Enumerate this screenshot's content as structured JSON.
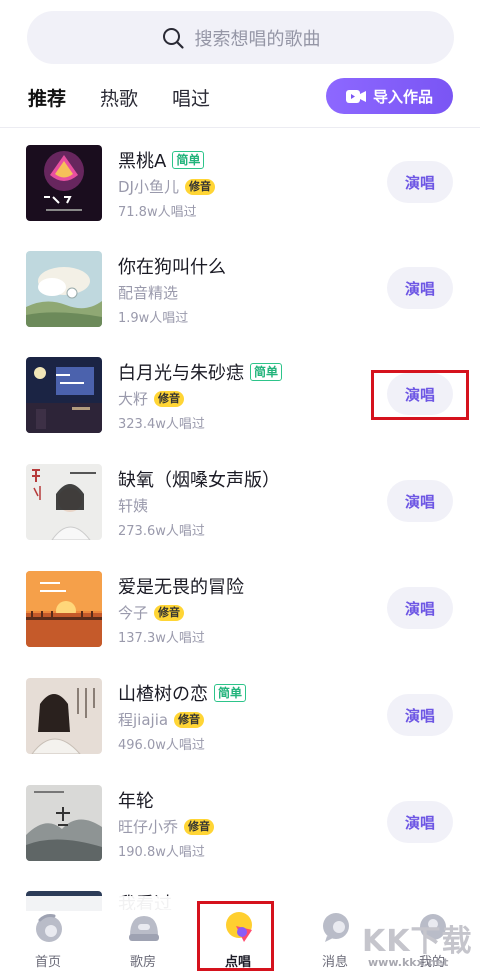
{
  "search": {
    "placeholder": "搜索想唱的歌曲"
  },
  "tabs": [
    {
      "label": "推荐",
      "active": true
    },
    {
      "label": "热歌",
      "active": false
    },
    {
      "label": "唱过",
      "active": false
    }
  ],
  "import_button": {
    "label": "导入作品"
  },
  "songs": [
    {
      "title": "黑桃A",
      "easy_tag": "简单",
      "artist": "DJ小鱼儿",
      "fix_tag": "修音",
      "count": "71.8w人唱过",
      "action": "演唱"
    },
    {
      "title": "你在狗叫什么",
      "easy_tag": "",
      "artist": "配音精选",
      "fix_tag": "",
      "count": "1.9w人唱过",
      "action": "演唱"
    },
    {
      "title": "白月光与朱砂痣",
      "easy_tag": "简单",
      "artist": "大籽",
      "fix_tag": "修音",
      "count": "323.4w人唱过",
      "action": "演唱"
    },
    {
      "title": "缺氧（烟嗓女声版）",
      "easy_tag": "",
      "artist": "轩姨",
      "fix_tag": "",
      "count": "273.6w人唱过",
      "action": "演唱"
    },
    {
      "title": "爱是无畏的冒险",
      "easy_tag": "",
      "artist": "今子",
      "fix_tag": "修音",
      "count": "137.3w人唱过",
      "action": "演唱"
    },
    {
      "title": "山楂树の恋",
      "easy_tag": "简单",
      "artist": "程jiajia",
      "fix_tag": "修音",
      "count": "496.0w人唱过",
      "action": "演唱"
    },
    {
      "title": "年轮",
      "easy_tag": "",
      "artist": "旺仔小乔",
      "fix_tag": "修音",
      "count": "190.8w人唱过",
      "action": "演唱"
    }
  ],
  "partial_song": {
    "title": "我看过"
  },
  "bottom_nav": [
    {
      "label": "首页",
      "active": false
    },
    {
      "label": "歌房",
      "active": false
    },
    {
      "label": "点唱",
      "active": true
    },
    {
      "label": "消息",
      "active": false
    },
    {
      "label": "我的",
      "active": false
    }
  ],
  "watermark": {
    "big": "KK下载",
    "small": "www.kkx.net"
  },
  "colors": {
    "accent": "#7a55f4",
    "highlight_box": "#d5121d",
    "easy_tag": "#2dc48a",
    "fix_tag": "#ffd535"
  }
}
